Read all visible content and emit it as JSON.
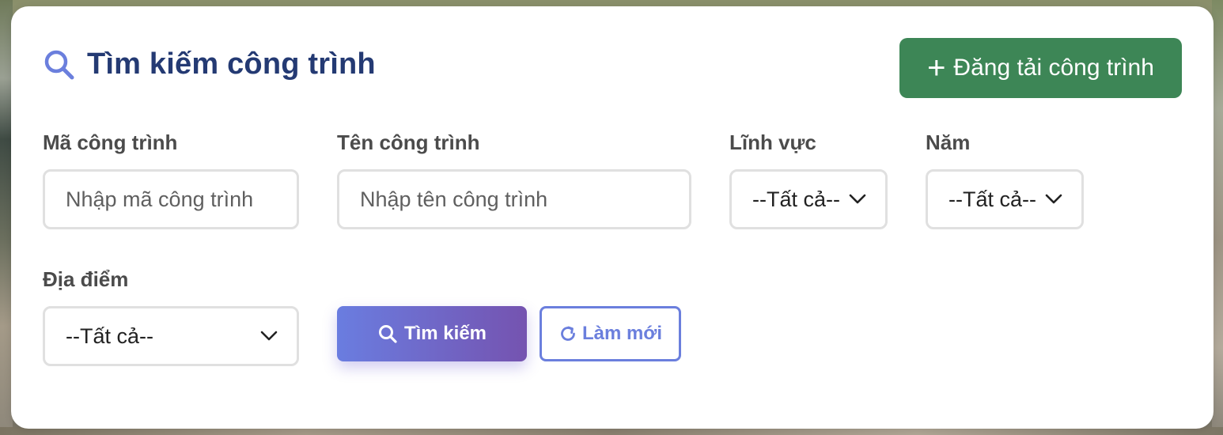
{
  "header": {
    "title": "Tìm kiếm công trình",
    "title_icon": "search-icon",
    "upload_button_label": "Đăng tải công trình",
    "upload_button_icon": "plus-icon"
  },
  "filters": {
    "code": {
      "label": "Mã công trình",
      "placeholder": "Nhập mã công trình",
      "value": ""
    },
    "name": {
      "label": "Tên công trình",
      "placeholder": "Nhập tên công trình",
      "value": ""
    },
    "field": {
      "label": "Lĩnh vực",
      "selected": "--Tất cả--"
    },
    "year": {
      "label": "Năm",
      "selected": "--Tất cả--"
    },
    "location": {
      "label": "Địa điểm",
      "selected": "--Tất cả--"
    }
  },
  "actions": {
    "search_label": "Tìm kiếm",
    "search_icon": "search-icon",
    "reset_label": "Làm mới",
    "reset_icon": "refresh-icon"
  },
  "colors": {
    "title": "#243a73",
    "accent": "#6b7fdd",
    "upload_button": "#3d8656",
    "search_gradient_start": "#6a7de0",
    "search_gradient_end": "#7553b0"
  }
}
